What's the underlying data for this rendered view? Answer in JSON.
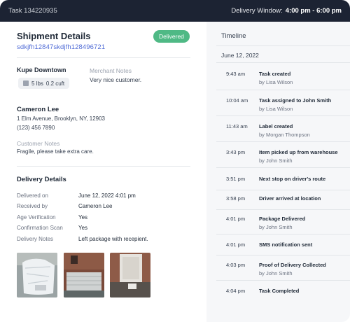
{
  "topbar": {
    "task_id": "Task 134220935",
    "window_label": "Delivery Window:",
    "window_value": "4:00 pm - 6:00 pm"
  },
  "shipment": {
    "title": "Shipment Details",
    "tracking": "sdkjfh12847skdjfh128496721",
    "status": "Delivered",
    "status_color": "#4fb985",
    "merchant_name": "Kupe Downtown",
    "package_weight": "5 lbs",
    "package_volume": "0.2 cuft",
    "merchant_notes_label": "Merchant Notes",
    "merchant_notes": "Very nice customer."
  },
  "customer": {
    "name": "Cameron Lee",
    "address": "1 Elm Avenue, Brooklyn, NY, 12903",
    "phone": "(123) 456 7890",
    "notes_label": "Customer Notes",
    "notes": "Fragile, please take extra care."
  },
  "delivery": {
    "title": "Delivery Details",
    "rows": [
      {
        "label": "Delivered on",
        "value": "June 12, 2022  4:01 pm"
      },
      {
        "label": "Received by",
        "value": "Cameron Lee"
      },
      {
        "label": "Age Verification",
        "value": "Yes"
      },
      {
        "label": "Confirmation Scan",
        "value": "Yes"
      },
      {
        "label": "Delivery Notes",
        "value": "Left package with recepient."
      }
    ]
  },
  "timeline": {
    "title": "Timeline",
    "date": "June 12, 2022",
    "events": [
      {
        "time": "9:43 am",
        "event": "Task created",
        "by": "by Lisa Wilson"
      },
      {
        "time": "10:04 am",
        "event": "Task assigned to John Smith",
        "by": "by Lisa Wilson"
      },
      {
        "time": "11:43 am",
        "event": "Label created",
        "by": "by Morgan Thompson"
      },
      {
        "time": "3:43 pm",
        "event": "Item picked up from warehouse",
        "by": "by John Smith"
      },
      {
        "time": "3:51 pm",
        "event": "Next stop on driver's route",
        "by": ""
      },
      {
        "time": "3:58 pm",
        "event": "Driver arrived at location",
        "by": ""
      },
      {
        "time": "4:01 pm",
        "event": "Package Delivered",
        "by": "by John Smith"
      },
      {
        "time": "4:01 pm",
        "event": "SMS notification sent",
        "by": ""
      },
      {
        "time": "4:03 pm",
        "event": "Proof of Delivery Collected",
        "by": "by John Smith"
      },
      {
        "time": "4:04 pm",
        "event": "Task Completed",
        "by": ""
      }
    ]
  },
  "colors": {
    "topbar": "#1c2333",
    "link": "#4f6bd6",
    "panel": "#f6f7f9"
  }
}
